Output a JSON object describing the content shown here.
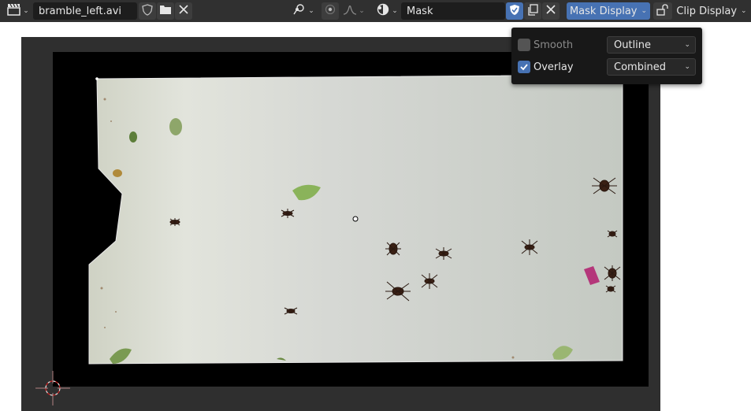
{
  "header": {
    "clip_name": "bramble_left.avi",
    "mask_name": "Mask",
    "mask_display_label": "Mask Display",
    "clip_display_label": "Clip Display"
  },
  "popover": {
    "smooth_label": "Smooth",
    "smooth_checked": false,
    "smooth_mode": "Outline",
    "overlay_label": "Overlay",
    "overlay_checked": true,
    "overlay_mode": "Combined"
  },
  "icons": {
    "editor_type": "movie-clip-icon",
    "shield": "fake-user-shield-icon",
    "folder": "open-folder-icon",
    "close": "close-icon",
    "pivot": "pivot-point-icon",
    "proportional": "proportional-editing-icon",
    "falloff": "falloff-curve-icon",
    "overlay_mode": "overlay-mode-icon",
    "copy": "duplicate-icon",
    "lock": "lock-icon"
  },
  "colors": {
    "header_bg": "#303030",
    "accent": "#4772b3",
    "viewport_bg": "#2f2f2f"
  }
}
